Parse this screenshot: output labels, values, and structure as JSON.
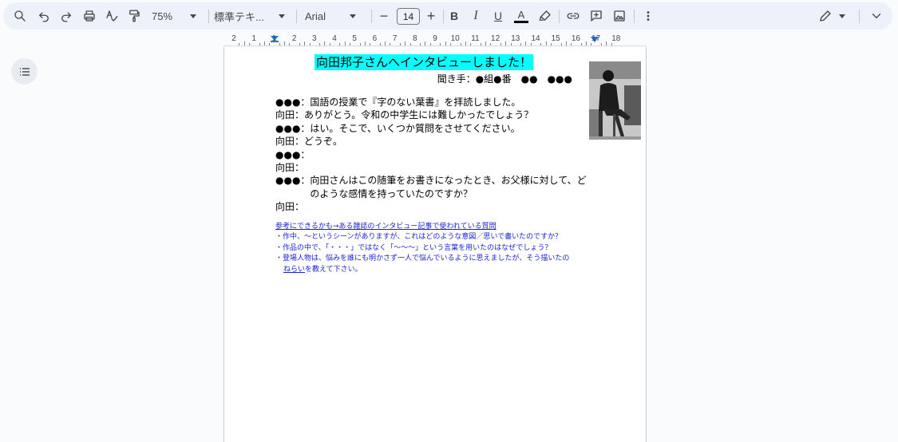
{
  "toolbar": {
    "zoom": "75%",
    "style": "標準テキ...",
    "font": "Arial",
    "font_size": "14",
    "bold": "B",
    "italic": "I",
    "underline": "U",
    "text_color": "A",
    "minus": "−",
    "plus": "+"
  },
  "ruler": {
    "labels": [
      "2",
      "1",
      "1",
      "2",
      "3",
      "4",
      "5",
      "6",
      "7",
      "8",
      "9",
      "10",
      "11",
      "12",
      "13",
      "14",
      "15",
      "16",
      "17",
      "18"
    ]
  },
  "document": {
    "title": "向田邦子さんへインタビューしました！",
    "interviewer": "聞き手：●組●番　●●　●●●",
    "lines": [
      {
        "speaker": "●●●：",
        "text": "国語の授業で『字のない葉書』を拝読しました。"
      },
      {
        "speaker": "向田：",
        "text": "ありがとう。令和の中学生には難しかったでしょう？"
      },
      {
        "speaker": "●●●：",
        "text": "はい。そこで、いくつか質問をさせてください。"
      },
      {
        "speaker": "向田：",
        "text": "どうぞ。"
      },
      {
        "speaker": "●●●：",
        "text": ""
      },
      {
        "speaker": "向田：",
        "text": ""
      },
      {
        "speaker": "●●●：",
        "text": "向田さんはこの随筆をお書きになったとき、お父様に対して、どのような感情を持っていたのですか？"
      },
      {
        "speaker": "向田：",
        "text": ""
      }
    ],
    "refs_title": "参考にできるかも→ある雑誌のインタビュー記事で使われている質問",
    "refs": [
      "・作中、～というシーンがありますが、これはどのような意図／思いで書いたのですか？",
      "・作品の中で、「・・・」ではなく「～～～」という言葉を用いたのはなぜでしょう？"
    ],
    "ref_last_a": "・登場人物は、悩みを誰にも明かさず一人で悩んでいるように思えましたが、そう描いたの",
    "ref_last_b": "ねらい",
    "ref_last_c": "を教えて下さい。"
  },
  "colors": {
    "highlight": "#00ffff",
    "link": "#1a23d4",
    "toolbar_bg": "#edf2fa"
  }
}
